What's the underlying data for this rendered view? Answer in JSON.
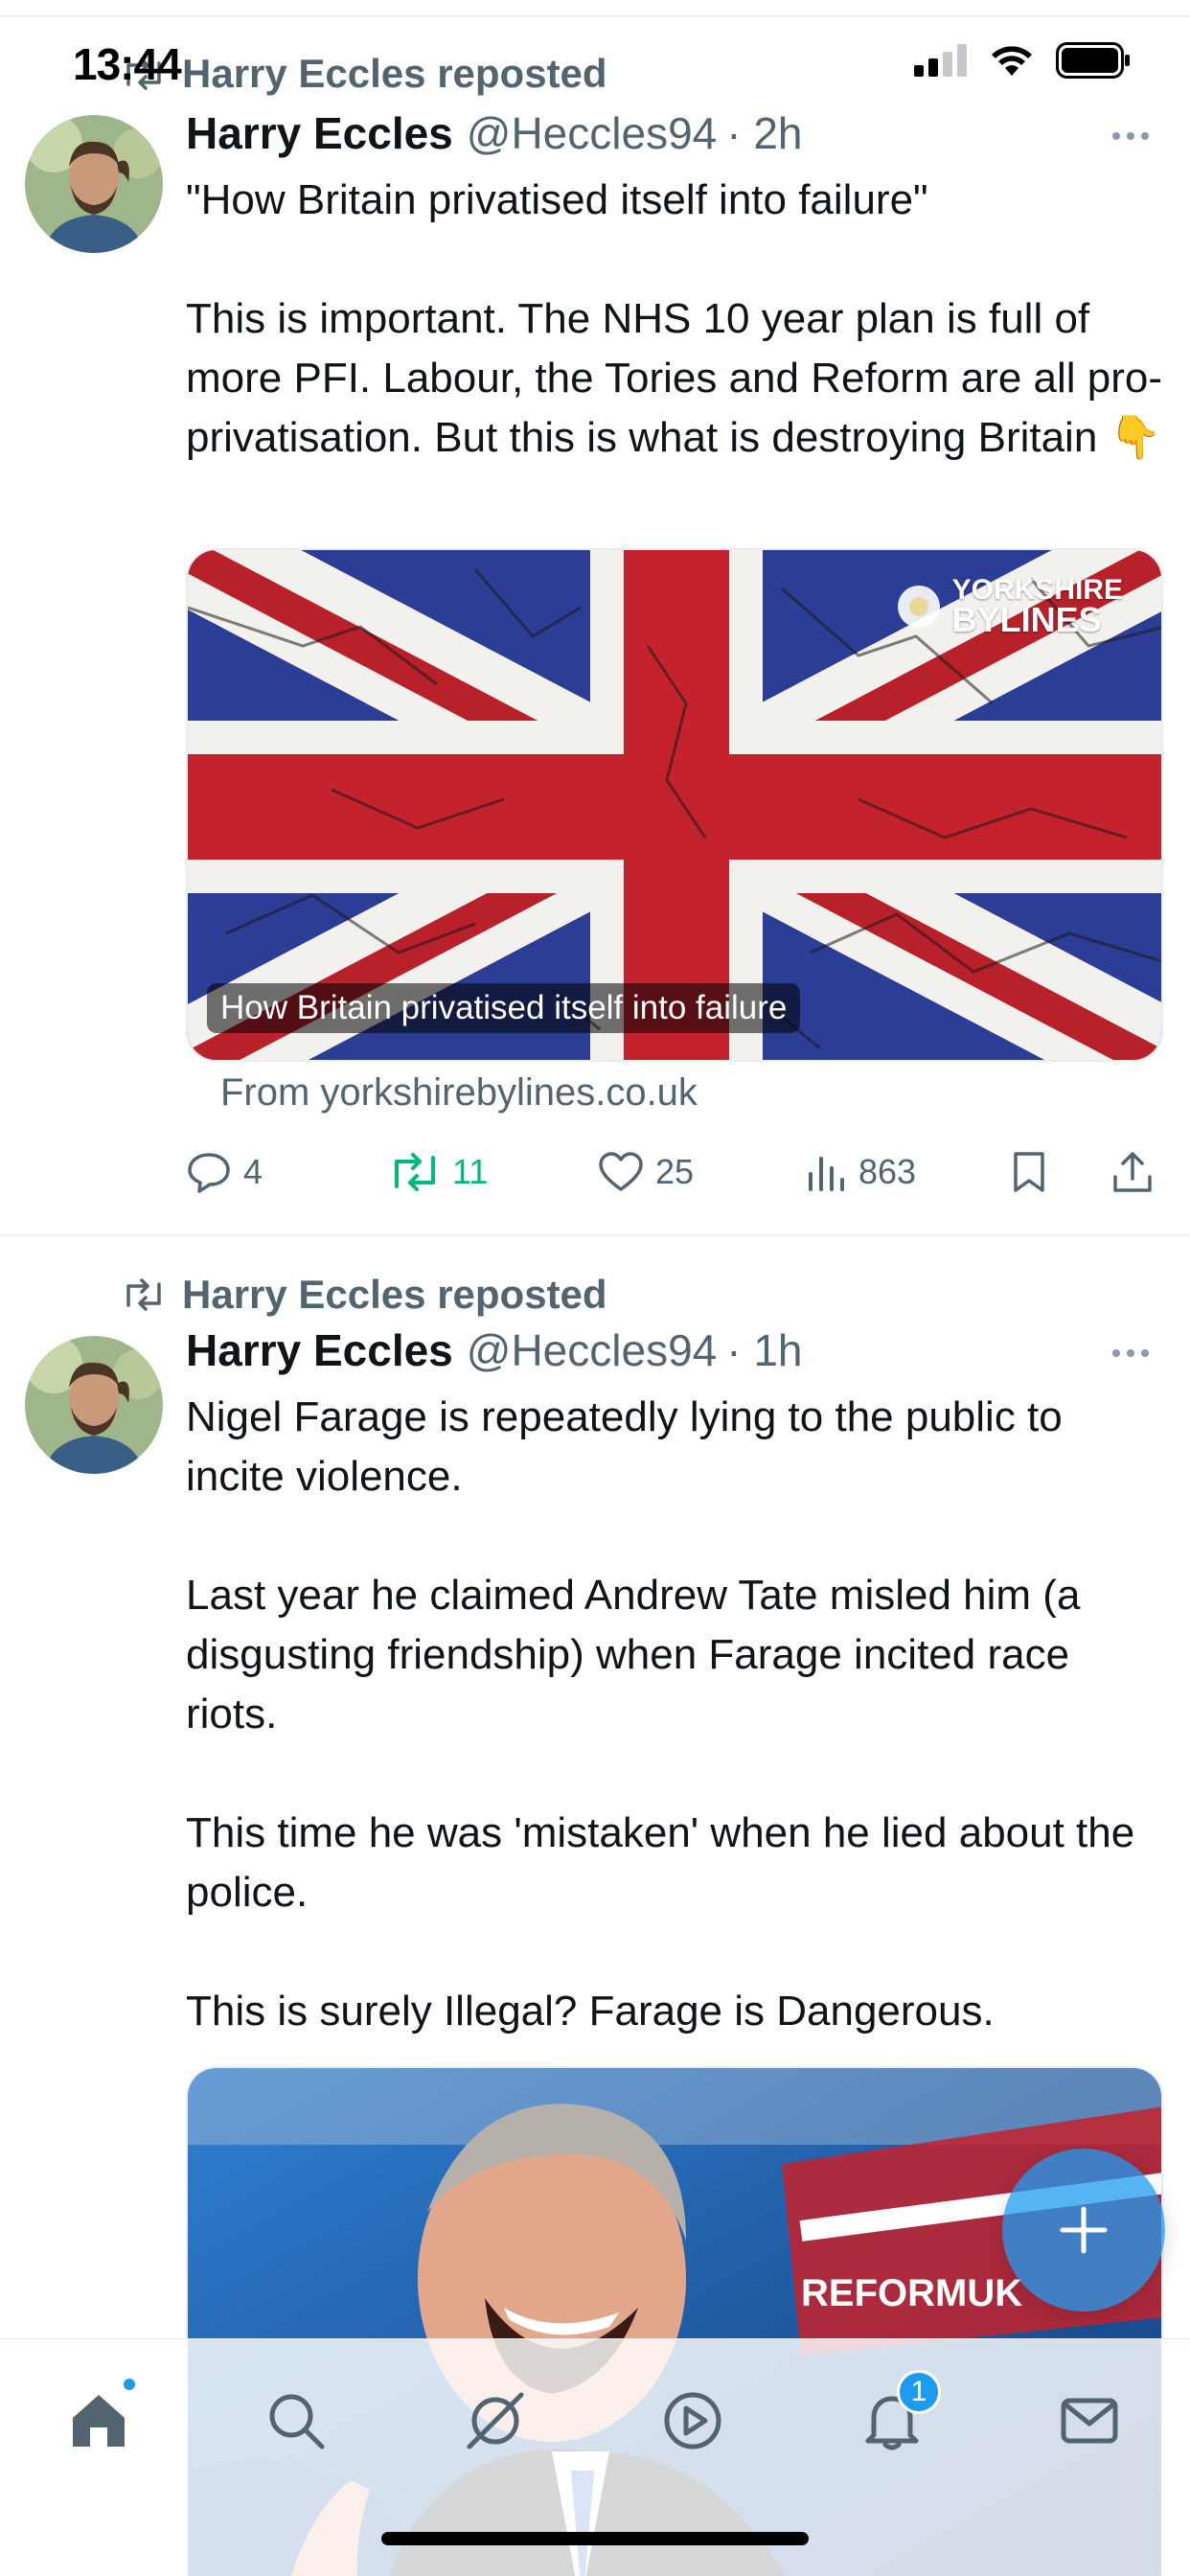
{
  "status_bar": {
    "time": "13:44"
  },
  "tweets": [
    {
      "repost_label": "Harry Eccles reposted",
      "author_name": "Harry Eccles",
      "author_handle": "@Heccles94",
      "time": "· 2h",
      "paragraphs": [
        "\"How Britain privatised itself into failure\"",
        "",
        "This is important. The NHS 10 year plan is full of more PFI. Labour, the Tories and Reform are all pro-privatisation. But this is what is destroying Britain 👇"
      ],
      "card": {
        "caption": "How Britain privatised itself into failure",
        "brand_line1": "YORKSHIRE",
        "brand_line2": "BYLINES",
        "source": "From yorkshirebylines.co.uk"
      },
      "actions": {
        "replies": "4",
        "reposts": "11",
        "likes": "25",
        "views": "863"
      }
    },
    {
      "repost_label": "Harry Eccles reposted",
      "author_name": "Harry Eccles",
      "author_handle": "@Heccles94",
      "time": "· 1h",
      "paragraphs": [
        "Nigel Farage is repeatedly lying to the public to incite violence.",
        "",
        "Last year he claimed Andrew Tate misled him (a disgusting friendship) when Farage incited race riots.",
        "",
        "This time he was 'mistaken' when he lied about the police.",
        "",
        "This is surely Illegal? Farage is Dangerous."
      ],
      "media": {
        "banner_text": "REFORMUK"
      }
    }
  ],
  "tab_bar": {
    "items": [
      "home-icon",
      "search-icon",
      "grok-icon",
      "video-icon",
      "notifications-icon",
      "messages-icon"
    ],
    "notifications_badge": "1"
  },
  "colors": {
    "accent": "#1d9bf0",
    "repost_green": "#00ba7c",
    "secondary_text": "#536471"
  }
}
